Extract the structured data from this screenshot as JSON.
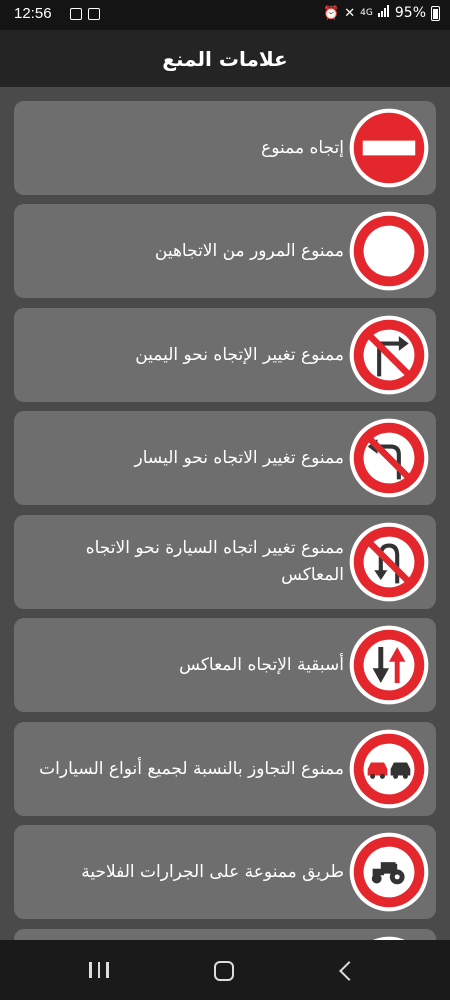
{
  "status": {
    "time": "12:56",
    "network_label": "4G",
    "battery_text": "95%",
    "left_icons": [
      "gallery-icon",
      "photo-icon"
    ],
    "right_icons": [
      "alarm-icon",
      "mute-icon",
      "signal-icon",
      "battery-icon"
    ]
  },
  "app_bar": {
    "title": "علامات المنع"
  },
  "signs": [
    {
      "label": "إتجاه ممنوع",
      "icon": "no-entry-sign-icon"
    },
    {
      "label": "ممنوع المرور من الاتجاهين",
      "icon": "no-vehicles-sign-icon"
    },
    {
      "label": "ممنوع تغيير الإتجاه نحو اليمين",
      "icon": "no-right-turn-sign-icon"
    },
    {
      "label": "ممنوع تغيير الاتجاه نحو اليسار",
      "icon": "no-left-turn-sign-icon"
    },
    {
      "label": "ممنوع تغيير اتجاه السيارة نحو الاتجاه المعاكس",
      "icon": "no-u-turn-sign-icon"
    },
    {
      "label": "أسبقية الإتجاه المعاكس",
      "icon": "priority-oncoming-sign-icon"
    },
    {
      "label": "ممنوع التجاوز بالنسبة لجميع أنواع السيارات",
      "icon": "no-overtaking-sign-icon"
    },
    {
      "label": "طريق ممنوعة على الجرارات الفلاحية",
      "icon": "no-tractors-sign-icon"
    },
    {
      "label": "",
      "icon": "partial-sign-icon"
    }
  ],
  "colors": {
    "sign_red": "#e4262d",
    "card_bg": "#6e6e6e",
    "page_bg": "#4a4a4a"
  }
}
